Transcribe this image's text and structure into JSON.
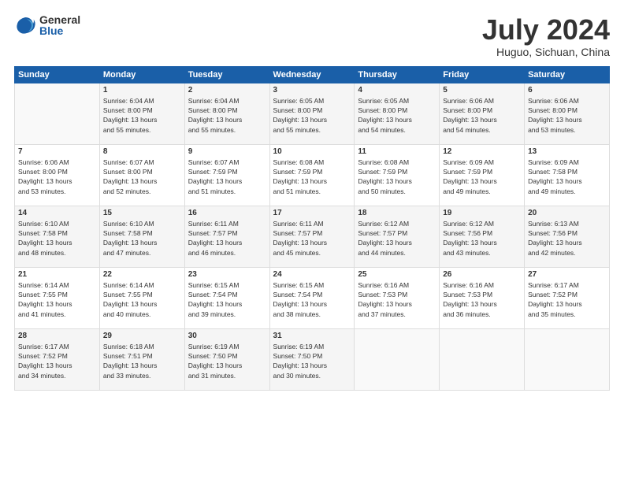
{
  "header": {
    "logo_general": "General",
    "logo_blue": "Blue",
    "main_title": "July 2024",
    "subtitle": "Huguo, Sichuan, China"
  },
  "calendar": {
    "days_of_week": [
      "Sunday",
      "Monday",
      "Tuesday",
      "Wednesday",
      "Thursday",
      "Friday",
      "Saturday"
    ],
    "weeks": [
      [
        {
          "day": "",
          "info": ""
        },
        {
          "day": "1",
          "info": "Sunrise: 6:04 AM\nSunset: 8:00 PM\nDaylight: 13 hours\nand 55 minutes."
        },
        {
          "day": "2",
          "info": "Sunrise: 6:04 AM\nSunset: 8:00 PM\nDaylight: 13 hours\nand 55 minutes."
        },
        {
          "day": "3",
          "info": "Sunrise: 6:05 AM\nSunset: 8:00 PM\nDaylight: 13 hours\nand 55 minutes."
        },
        {
          "day": "4",
          "info": "Sunrise: 6:05 AM\nSunset: 8:00 PM\nDaylight: 13 hours\nand 54 minutes."
        },
        {
          "day": "5",
          "info": "Sunrise: 6:06 AM\nSunset: 8:00 PM\nDaylight: 13 hours\nand 54 minutes."
        },
        {
          "day": "6",
          "info": "Sunrise: 6:06 AM\nSunset: 8:00 PM\nDaylight: 13 hours\nand 53 minutes."
        }
      ],
      [
        {
          "day": "7",
          "info": ""
        },
        {
          "day": "8",
          "info": "Sunrise: 6:07 AM\nSunset: 8:00 PM\nDaylight: 13 hours\nand 52 minutes."
        },
        {
          "day": "9",
          "info": "Sunrise: 6:07 AM\nSunset: 7:59 PM\nDaylight: 13 hours\nand 51 minutes."
        },
        {
          "day": "10",
          "info": "Sunrise: 6:08 AM\nSunset: 7:59 PM\nDaylight: 13 hours\nand 51 minutes."
        },
        {
          "day": "11",
          "info": "Sunrise: 6:08 AM\nSunset: 7:59 PM\nDaylight: 13 hours\nand 50 minutes."
        },
        {
          "day": "12",
          "info": "Sunrise: 6:09 AM\nSunset: 7:59 PM\nDaylight: 13 hours\nand 49 minutes."
        },
        {
          "day": "13",
          "info": "Sunrise: 6:09 AM\nSunset: 7:58 PM\nDaylight: 13 hours\nand 49 minutes."
        }
      ],
      [
        {
          "day": "14",
          "info": ""
        },
        {
          "day": "15",
          "info": "Sunrise: 6:10 AM\nSunset: 7:58 PM\nDaylight: 13 hours\nand 47 minutes."
        },
        {
          "day": "16",
          "info": "Sunrise: 6:11 AM\nSunset: 7:57 PM\nDaylight: 13 hours\nand 46 minutes."
        },
        {
          "day": "17",
          "info": "Sunrise: 6:11 AM\nSunset: 7:57 PM\nDaylight: 13 hours\nand 45 minutes."
        },
        {
          "day": "18",
          "info": "Sunrise: 6:12 AM\nSunset: 7:57 PM\nDaylight: 13 hours\nand 44 minutes."
        },
        {
          "day": "19",
          "info": "Sunrise: 6:12 AM\nSunset: 7:56 PM\nDaylight: 13 hours\nand 43 minutes."
        },
        {
          "day": "20",
          "info": "Sunrise: 6:13 AM\nSunset: 7:56 PM\nDaylight: 13 hours\nand 42 minutes."
        }
      ],
      [
        {
          "day": "21",
          "info": "Sunrise: 6:14 AM\nSunset: 7:55 PM\nDaylight: 13 hours\nand 41 minutes."
        },
        {
          "day": "22",
          "info": "Sunrise: 6:14 AM\nSunset: 7:55 PM\nDaylight: 13 hours\nand 40 minutes."
        },
        {
          "day": "23",
          "info": "Sunrise: 6:15 AM\nSunset: 7:54 PM\nDaylight: 13 hours\nand 39 minutes."
        },
        {
          "day": "24",
          "info": "Sunrise: 6:15 AM\nSunset: 7:54 PM\nDaylight: 13 hours\nand 38 minutes."
        },
        {
          "day": "25",
          "info": "Sunrise: 6:16 AM\nSunset: 7:53 PM\nDaylight: 13 hours\nand 37 minutes."
        },
        {
          "day": "26",
          "info": "Sunrise: 6:16 AM\nSunset: 7:53 PM\nDaylight: 13 hours\nand 36 minutes."
        },
        {
          "day": "27",
          "info": "Sunrise: 6:17 AM\nSunset: 7:52 PM\nDaylight: 13 hours\nand 35 minutes."
        }
      ],
      [
        {
          "day": "28",
          "info": "Sunrise: 6:17 AM\nSunset: 7:52 PM\nDaylight: 13 hours\nand 34 minutes."
        },
        {
          "day": "29",
          "info": "Sunrise: 6:18 AM\nSunset: 7:51 PM\nDaylight: 13 hours\nand 33 minutes."
        },
        {
          "day": "30",
          "info": "Sunrise: 6:19 AM\nSunset: 7:50 PM\nDaylight: 13 hours\nand 31 minutes."
        },
        {
          "day": "31",
          "info": "Sunrise: 6:19 AM\nSunset: 7:50 PM\nDaylight: 13 hours\nand 30 minutes."
        },
        {
          "day": "",
          "info": ""
        },
        {
          "day": "",
          "info": ""
        },
        {
          "day": "",
          "info": ""
        }
      ]
    ],
    "week1_sun_info": "Sunrise: 6:06 AM\nSunset: 8:00 PM\nDaylight: 13 hours\nand 53 minutes.",
    "week2_sun_info": "Sunrise: 6:06 AM\nSunset: 8:00 PM\nDaylight: 13 hours\nand 53 minutes.",
    "week3_sun_info": "Sunrise: 6:10 AM\nSunset: 7:58 PM\nDaylight: 13 hours\nand 48 minutes."
  }
}
